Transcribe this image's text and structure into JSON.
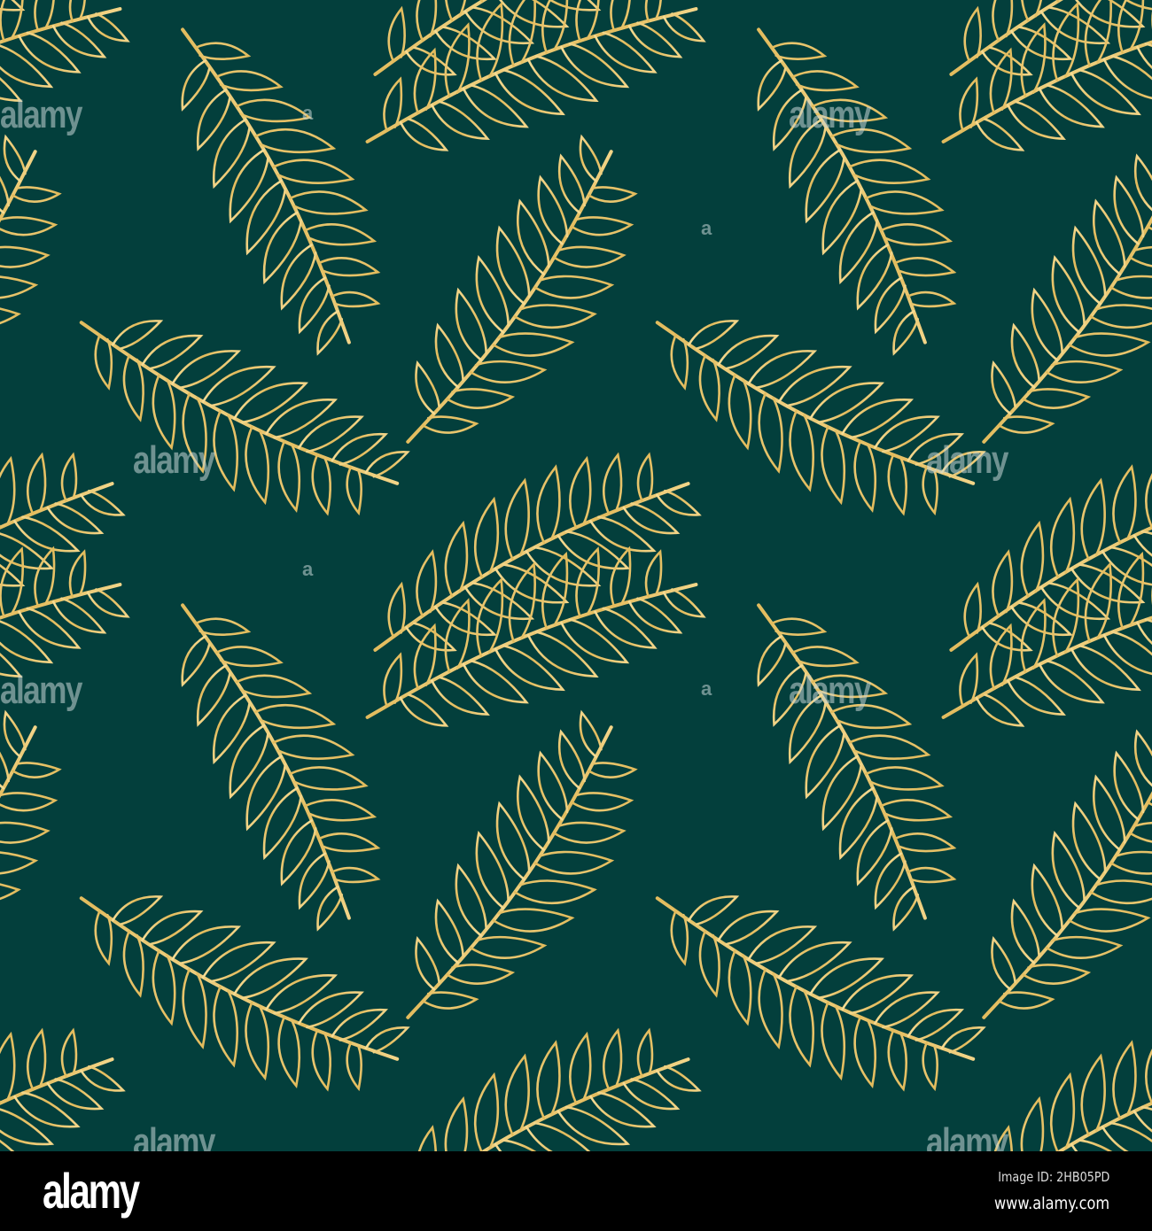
{
  "colors": {
    "background": "#033f3c",
    "gold_light": "#f6dc95",
    "gold_dark": "#d9ac47",
    "footer": "#000000"
  },
  "watermark": {
    "text": "alamy",
    "letter": "a"
  },
  "footer": {
    "logo": "alamy",
    "image_id": "Image ID: 2HB05PD",
    "url": "www.alamy.com"
  }
}
